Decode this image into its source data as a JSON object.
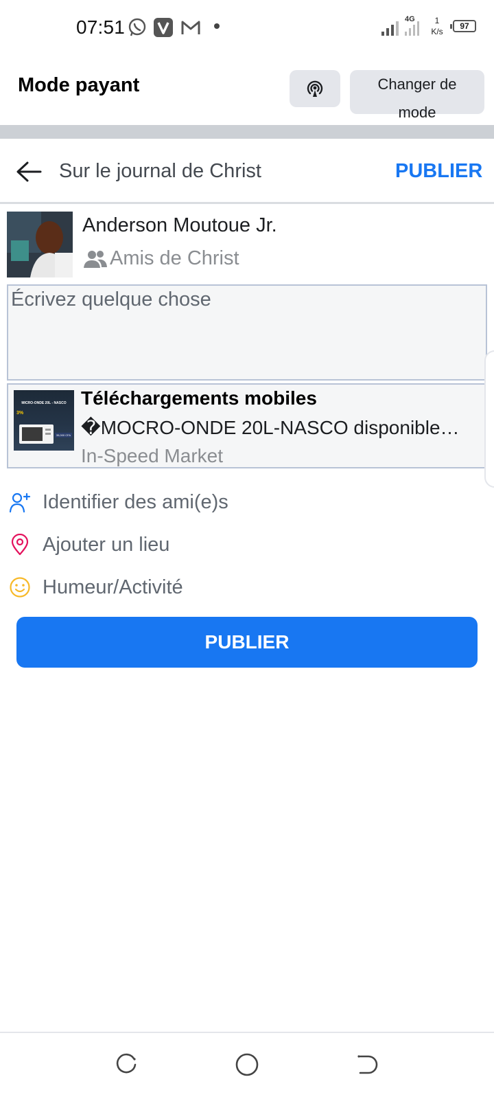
{
  "status_bar": {
    "time": "07:51",
    "network": "4G",
    "net_speed_value": "1",
    "net_speed_unit": "K/s",
    "battery": "97",
    "notification_icons": [
      "whatsapp-icon",
      "v-app-icon",
      "gmail-icon"
    ]
  },
  "mode_header": {
    "title": "Mode payant",
    "icon": "broadcast-icon",
    "change_mode_label": "Changer de mode"
  },
  "composer": {
    "title": "Sur le journal de Christ",
    "publish_label": "PUBLIER",
    "back_icon": "arrow-left-icon"
  },
  "profile": {
    "name": "Anderson Moutoue Jr.",
    "audience": "Amis de Christ",
    "audience_icon": "friends-icon"
  },
  "post_input": {
    "placeholder": "Écrivez quelque chose"
  },
  "link_preview": {
    "title": "Téléchargements mobiles",
    "description": "�MOCRO-ONDE 20L-NASCO disponible…",
    "source": "In-Speed Market",
    "thumbnail_title": "MICRO-ONDE 20L - NASCO",
    "thumbnail_badge": "3%",
    "thumbnail_price": "35,000 CFA"
  },
  "actions": [
    {
      "label": "Identifier des ami(e)s",
      "icon": "add-friend-icon",
      "color": "#1877f2"
    },
    {
      "label": "Ajouter un lieu",
      "icon": "location-pin-icon",
      "color": "#e4125d"
    },
    {
      "label": "Humeur/Activité",
      "icon": "smiley-icon",
      "color": "#f7b928"
    }
  ],
  "publish_button": {
    "label": "PUBLIER"
  },
  "nav_bar": {
    "buttons": [
      "recent-apps-icon",
      "home-icon",
      "back-icon"
    ]
  },
  "colors": {
    "accent": "#1877f2",
    "separator": "#ccd0d5",
    "muted_text": "#8a8d91"
  }
}
